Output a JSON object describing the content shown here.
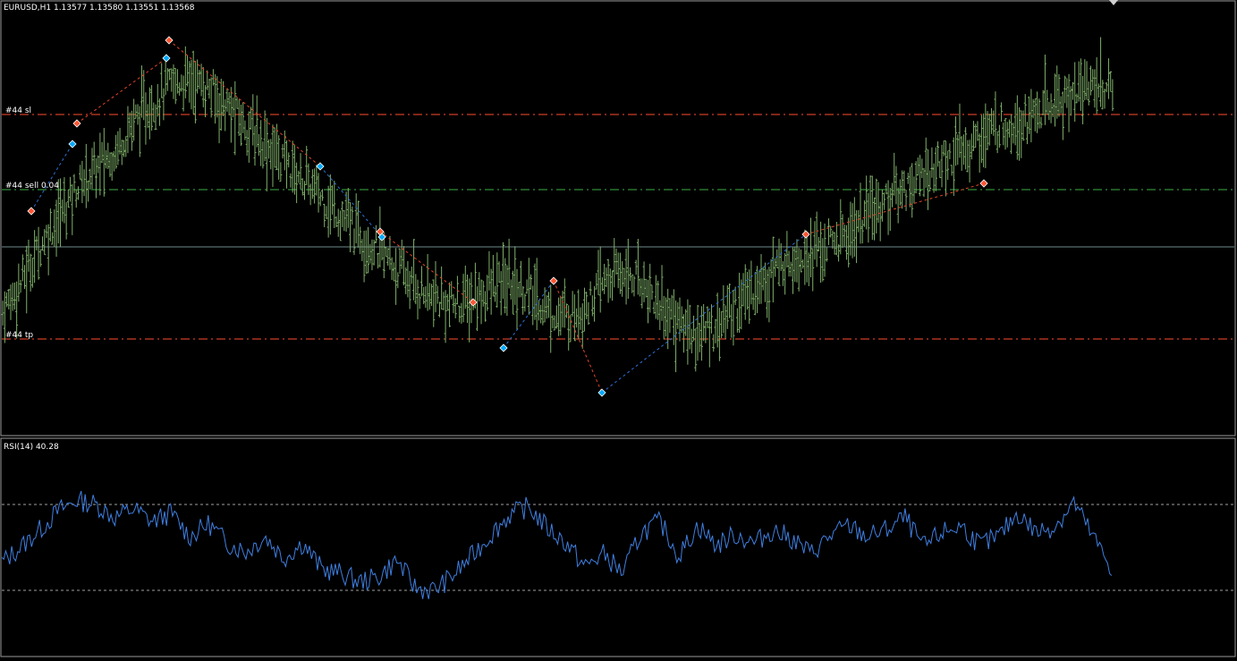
{
  "main_chart": {
    "title": "EURUSD,H1  1.13577 1.13580 1.13551 1.13568",
    "symbol": "EURUSD",
    "timeframe": "H1",
    "ohlc": {
      "open": 1.13577,
      "high": 1.1358,
      "low": 1.13551,
      "close": 1.13568
    },
    "bar_color": "#7fb069",
    "background": "#000000",
    "levels": [
      {
        "label": "#44 sl",
        "style": "dash-dot",
        "color": "#ff4d2e"
      },
      {
        "label": "#44 sell 0.04",
        "style": "dash-dot",
        "color": "#3cb043"
      },
      {
        "label": "",
        "style": "solid",
        "color": "#6f8a8e"
      },
      {
        "label": "#44 tp",
        "style": "dash-dot",
        "color": "#ff4d2e"
      }
    ],
    "trade_markers": {
      "buy_color": "#00aaff",
      "sell_color": "#ff5533",
      "connector_buy_color": "#2e6fd6",
      "connector_sell_color": "#e0442a"
    }
  },
  "rsi_panel": {
    "title": "RSI(14) 40.28",
    "indicator": "RSI",
    "period": 14,
    "current_value": 40.28,
    "line_color": "#3f7fe0",
    "levels": [
      70,
      30
    ]
  },
  "chart_data": {
    "type": "line",
    "price_series": [
      1.132,
      1.1325,
      1.1331,
      1.1336,
      1.1341,
      1.1344,
      1.1347,
      1.1352,
      1.1355,
      1.1358,
      1.1359,
      1.1357,
      1.1354,
      1.1351,
      1.1348,
      1.1345,
      1.1342,
      1.1339,
      1.1336,
      1.1333,
      1.133,
      1.1327,
      1.1324,
      1.1322,
      1.1321,
      1.1322,
      1.1324,
      1.1325,
      1.1323,
      1.132,
      1.1319,
      1.1321,
      1.1325,
      1.1327,
      1.1325,
      1.1321,
      1.1318,
      1.1316,
      1.1318,
      1.1321,
      1.1324,
      1.1327,
      1.1329,
      1.133,
      1.1331,
      1.1333,
      1.1336,
      1.1339,
      1.1341,
      1.1343,
      1.1345,
      1.1347,
      1.1349,
      1.1351,
      1.1352,
      1.1353,
      1.1355,
      1.1357,
      1.1358,
      1.1357
    ],
    "rsi_series": [
      43,
      50,
      58,
      67,
      72,
      70,
      64,
      68,
      62,
      66,
      55,
      61,
      52,
      48,
      55,
      45,
      52,
      40,
      38,
      34,
      36,
      44,
      31,
      30,
      37,
      46,
      56,
      65,
      69,
      59,
      52,
      41,
      47,
      38,
      57,
      62,
      46,
      60,
      51,
      56,
      52,
      58,
      54,
      47,
      55,
      60,
      55,
      58,
      64,
      50,
      57,
      60,
      51,
      55,
      66,
      57,
      60,
      71,
      55,
      40
    ]
  }
}
